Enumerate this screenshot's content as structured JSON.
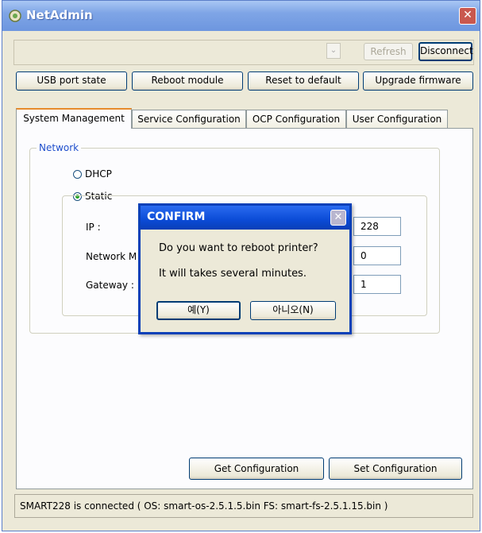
{
  "window": {
    "title": "NetAdmin",
    "close_symbol": "✕"
  },
  "toolbar": {
    "combo_arrow": "⌄",
    "refresh_label": "Refresh",
    "disconnect_label": "Disconnect"
  },
  "actions": {
    "usb_port_state": "USB port state",
    "reboot_module": "Reboot module",
    "reset_to_default": "Reset to default",
    "upgrade_firmware": "Upgrade firmware"
  },
  "tabs": [
    {
      "label": "System Management",
      "active": true
    },
    {
      "label": "Service Configuration",
      "active": false
    },
    {
      "label": "OCP Configuration",
      "active": false
    },
    {
      "label": "User Configuration",
      "active": false
    }
  ],
  "network": {
    "legend": "Network",
    "dhcp_label": "DHCP",
    "static_label": "Static",
    "selected": "Static",
    "ip_label": "IP :",
    "ip_value": "228",
    "netmask_label": "Network M",
    "netmask_value": "0",
    "gateway_label": "Gateway :",
    "gateway_value": "1"
  },
  "footer": {
    "get_configuration": "Get Configuration",
    "set_configuration": "Set Configuration"
  },
  "status_bar": "SMART228 is connected ( OS: smart-os-2.5.1.5.bin  FS: smart-fs-2.5.1.15.bin )",
  "dialog": {
    "title": "CONFIRM",
    "close_symbol": "✕",
    "message_line1": "Do you want to reboot printer?",
    "message_line2": "It will takes several minutes.",
    "yes_label": "예(Y)",
    "no_label": "아니오(N)"
  },
  "colors": {
    "titlebar": "#7fa5e6",
    "dialog_titlebar": "#0b4bd6",
    "active_tab_accent": "#e68b2c",
    "legend_text": "#1f4fcc"
  }
}
